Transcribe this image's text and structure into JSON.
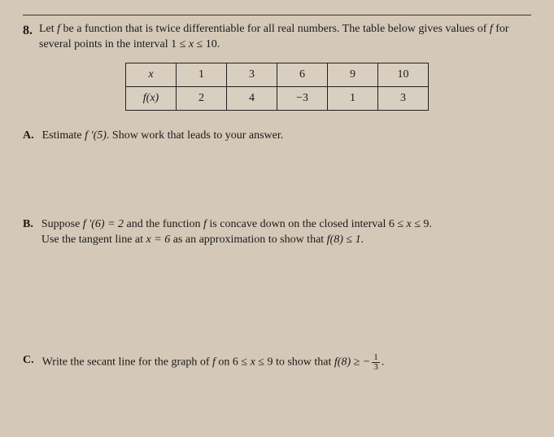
{
  "question": {
    "number": "8.",
    "intro_part1": "Let ",
    "intro_f": "f",
    "intro_part2": " be a function that is twice differentiable for all real numbers. The table below gives values of ",
    "intro_f2": "f",
    "intro_part3": " for several points in the interval 1 ≤ ",
    "intro_x": "x",
    "intro_part4": " ≤ 10."
  },
  "table": {
    "row1": [
      "x",
      "1",
      "3",
      "6",
      "9",
      "10"
    ],
    "row2": [
      "f(x)",
      "2",
      "4",
      "−3",
      "1",
      "3"
    ]
  },
  "chart_data": {
    "type": "table",
    "columns": [
      "x",
      "f(x)"
    ],
    "rows": [
      {
        "x": 1,
        "fx": 2
      },
      {
        "x": 3,
        "fx": 4
      },
      {
        "x": 6,
        "fx": -3
      },
      {
        "x": 9,
        "fx": 1
      },
      {
        "x": 10,
        "fx": 3
      }
    ],
    "title": "Values of f for several points in the interval 1 ≤ x ≤ 10"
  },
  "partA": {
    "label": "A.",
    "text1": "Estimate ",
    "expr": "f ′(5)",
    "text2": ". Show work that leads to your answer."
  },
  "partB": {
    "label": "B.",
    "line1a": "Suppose ",
    "expr1": "f ′(6) = 2",
    "line1b": " and the function ",
    "f": "f",
    "line1c": " is concave down on the closed interval 6 ≤ ",
    "x": "x",
    "line1d": " ≤ 9.",
    "line2a": "Use the tangent line at ",
    "expr2": "x = 6",
    "line2b": " as an approximation to show that ",
    "expr3": "f(8) ≤ 1",
    "line2c": "."
  },
  "partC": {
    "label": "C.",
    "text1": "Write the secant line for the graph of ",
    "f": "f",
    "text2": " on 6 ≤ ",
    "x": "x",
    "text3": " ≤ 9 to show that ",
    "expr1": "f(8) ≥ −",
    "frac_num": "1",
    "frac_den": "3",
    "text4": "."
  }
}
